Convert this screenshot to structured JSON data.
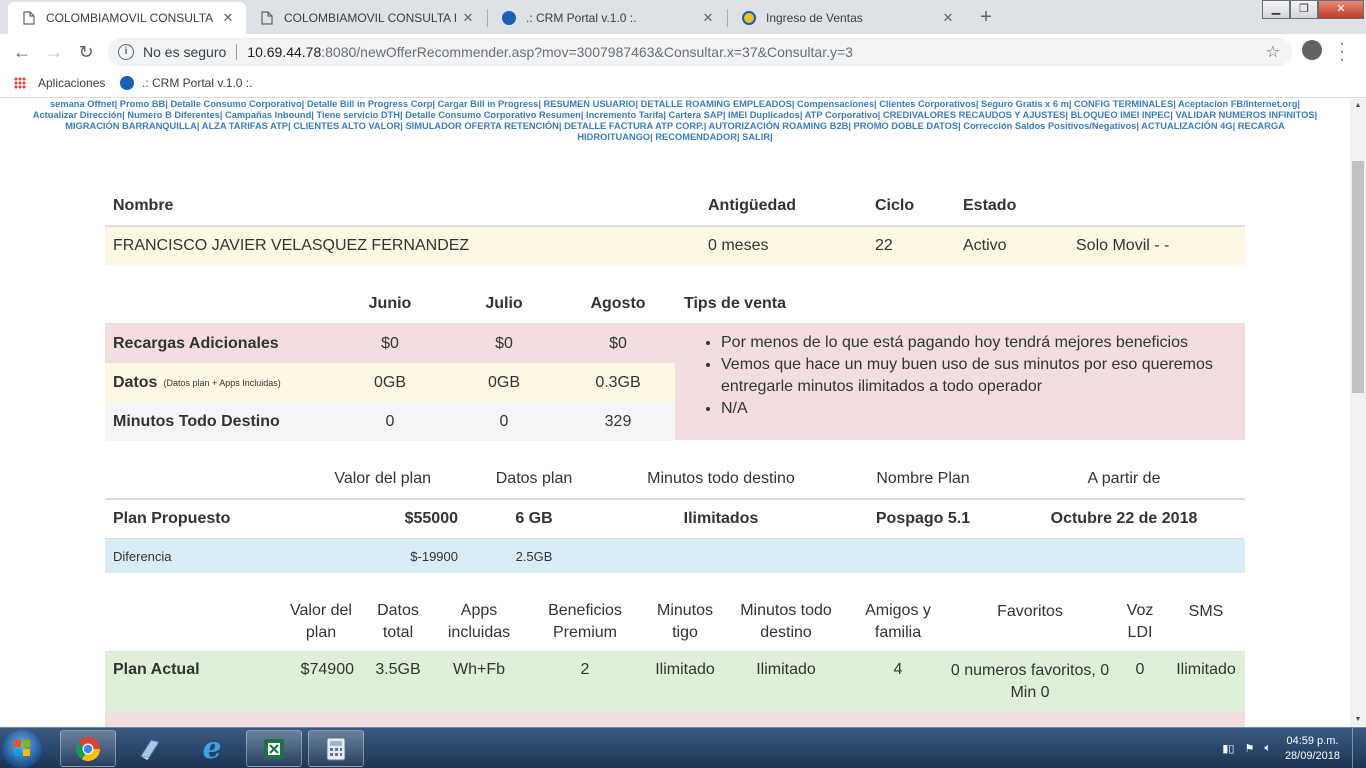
{
  "browser": {
    "tabs": [
      {
        "title": "COLOMBIAMOVIL CONSULTA IN",
        "icon": "page-icon",
        "active": true
      },
      {
        "title": "COLOMBIAMOVIL CONSULTA IN",
        "icon": "page-icon",
        "active": false
      },
      {
        "title": ".: CRM Portal v.1.0 :.",
        "icon": "crm-icon",
        "active": false
      },
      {
        "title": "Ingreso de Ventas",
        "icon": "crm-icon",
        "active": false
      }
    ],
    "new_tab": "+",
    "security": "No es seguro",
    "url_host": "10.69.44.78",
    "url_path": ":8080/newOfferRecommender.asp?mov=3007987463&Consultar.x=37&Consultar.y=3",
    "bookmarks": [
      {
        "label": "Aplicaciones",
        "icon": "apps-grid-icon"
      },
      {
        "label": ".: CRM Portal v.1.0 :.",
        "icon": "crm-icon"
      }
    ]
  },
  "nav_links": [
    "semana Offnet",
    "Promo BB",
    "Detalle Consumo Corporativo",
    "Detalle Bill in Progress Corp",
    "Cargar Bill in Progress",
    "RESUMEN USUARIO",
    "DETALLE ROAMING EMPLEADOS",
    "Compensaciones",
    "Clientes Corporativos",
    "Seguro Gratis x 6 m",
    "CONFIG TERMINALES",
    "Aceptacion FB/Internet.org",
    "Actualizar Dirección",
    "Numero B Diferentes",
    "Campañas Inbound",
    "Tiene servicio DTH",
    "Detalle Consumo Corporativo Resumen",
    "Incremento Tarifa",
    "Cartera SAP",
    "IMEI Duplicados",
    "ATP Corporativo",
    "CREDIVALORES RECAUDOS Y AJUSTES",
    "BLOQUEO IMEI INPEC",
    "VALIDAR NUMEROS INFINITOS",
    "MIGRACIÓN BARRANQUILLA",
    "ALZA TARIFAS ATP",
    "CLIENTES ALTO VALOR",
    "SIMULADOR OFERTA RETENCIÓN",
    "DETALLE FACTURA ATP CORP.",
    "AUTORIZACIÓN ROAMING B2B",
    "PROMO DOBLE DATOS",
    "Corrección Saldos Positivos/Negativos",
    "ACTUALIZACIÓN 4G",
    "RECARGA HIDROITUANGO",
    "RECOMENDADOR",
    "SALIR"
  ],
  "customer": {
    "headers": {
      "name": "Nombre",
      "age": "Antigüedad",
      "cycle": "Ciclo",
      "status": "Estado"
    },
    "name": "FRANCISCO JAVIER VELASQUEZ FERNANDEZ",
    "age": "0 meses",
    "cycle": "22",
    "status": "Activo",
    "extra": "Solo Movil - -"
  },
  "usage": {
    "months": [
      "Junio",
      "Julio",
      "Agosto"
    ],
    "tips_header": "Tips de venta",
    "rows": [
      {
        "label": "Recargas Adicionales",
        "note": "",
        "values": [
          "$0",
          "$0",
          "$0"
        ]
      },
      {
        "label": "Datos",
        "note": "(Datos plan + Apps Incluidas)",
        "values": [
          "0GB",
          "0GB",
          "0.3GB"
        ]
      },
      {
        "label": "Minutos Todo Destino",
        "note": "",
        "values": [
          "0",
          "0",
          "329"
        ]
      }
    ],
    "tips": [
      "Por menos de lo que está pagando hoy tendrá mejores beneficios",
      "Vemos que hace un muy buen uso de sus minutos por eso queremos entregarle minutos ilimitados a todo operador",
      "N/A"
    ]
  },
  "proposed": {
    "headers": [
      "Valor del plan",
      "Datos plan",
      "Minutos todo destino",
      "Nombre Plan",
      "A partir de"
    ],
    "label": "Plan Propuesto",
    "values": [
      "$55000",
      "6 GB",
      "Ilimitados",
      "Pospago 5.1",
      "Octubre 22 de 2018"
    ],
    "diff_label": "Diferencia",
    "diff_values": [
      "$-19900",
      "2.5GB"
    ]
  },
  "current": {
    "headers": [
      "Valor del plan",
      "Datos total",
      "Apps incluidas",
      "Beneficios Premium",
      "Minutos tigo",
      "Minutos todo destino",
      "Amigos y familia",
      "Favoritos",
      "Voz LDI",
      "SMS"
    ],
    "label": "Plan Actual",
    "values": [
      "$74900",
      "3.5GB",
      "Wh+Fb",
      "2",
      "Ilimitado",
      "Ilimitado",
      "4",
      "0 numeros favoritos, 0 Min 0",
      "0",
      "Ilimitado"
    ]
  },
  "taskbar": {
    "time": "04:59 p.m.",
    "date": "28/09/2018",
    "apps": [
      "chrome-icon",
      "notepad-icon",
      "ie-icon",
      "excel-icon",
      "calculator-icon"
    ]
  }
}
